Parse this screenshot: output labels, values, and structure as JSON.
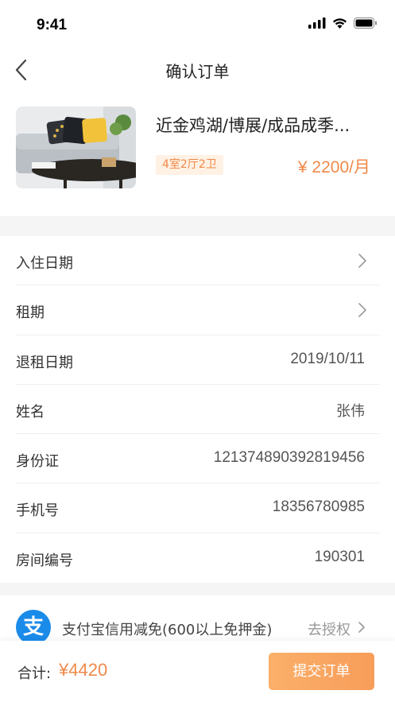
{
  "status_bar": {
    "time": "9:41"
  },
  "nav": {
    "title": "确认订单"
  },
  "house": {
    "title": "近金鸡湖/博展/成品成季...",
    "tag": "4室2厅2卫",
    "price": "¥ 2200/月"
  },
  "form": {
    "rows": [
      {
        "label": "入住日期",
        "value": ""
      },
      {
        "label": "租期",
        "value": ""
      },
      {
        "label": "退租日期",
        "value": "2019/10/11"
      },
      {
        "label": "姓名",
        "value": "张伟"
      },
      {
        "label": "身份证",
        "value": "121374890392819456"
      },
      {
        "label": "手机号",
        "value": "18356780985"
      },
      {
        "label": "房间编号",
        "value": "190301"
      }
    ]
  },
  "alipay": {
    "logo": "支",
    "text": "支付宝信用减免(600以上免押金)",
    "auth": "去授权"
  },
  "footer": {
    "total_label": "合计:",
    "total_value": "¥4420",
    "submit_label": "提交订单"
  },
  "colors": {
    "accent": "#f0894a",
    "tag_bg": "#fff1e3",
    "alipay_blue": "#1b8bea"
  }
}
